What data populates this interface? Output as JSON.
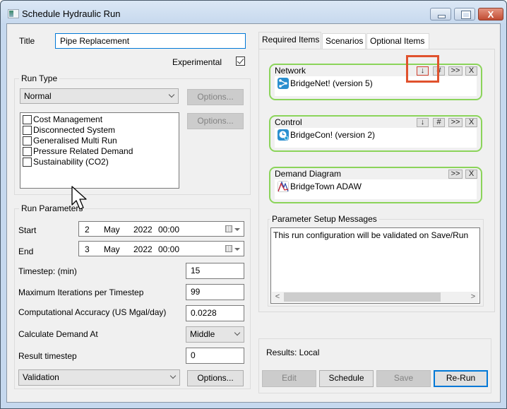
{
  "window": {
    "title": "Schedule Hydraulic Run",
    "controls": {
      "minimize": "minimize",
      "maximize": "maximize",
      "close": "X"
    }
  },
  "general": {
    "title_label": "Title",
    "title_value": "Pipe Replacement",
    "experimental_label": "Experimental",
    "experimental_checked": true
  },
  "run_type": {
    "group_label": "Run Type",
    "selected": "Normal",
    "options_button_1": "Options...",
    "options_button_2": "Options...",
    "modules": [
      {
        "label": "Cost Management",
        "checked": false
      },
      {
        "label": "Disconnected System",
        "checked": false
      },
      {
        "label": "Generalised Multi Run",
        "checked": false
      },
      {
        "label": "Pressure Related Demand",
        "checked": false
      },
      {
        "label": "Sustainability (CO2)",
        "checked": false
      }
    ]
  },
  "run_parameters": {
    "group_label": "Run Parameters",
    "start_label": "Start",
    "start": {
      "day": "2",
      "month": "May",
      "year": "2022",
      "time": "00:00"
    },
    "end_label": "End",
    "end": {
      "day": "3",
      "month": "May",
      "year": "2022",
      "time": "00:00"
    },
    "timestep_label": "Timestep: (min)",
    "timestep_value": "15",
    "max_iterations_label": "Maximum Iterations per Timestep",
    "max_iterations_value": "99",
    "accuracy_label": "Computational Accuracy (US Mgal/day)",
    "accuracy_value": "0.0228",
    "demand_at_label": "Calculate Demand At",
    "demand_at_value": "Middle",
    "result_timestep_label": "Result timestep",
    "result_timestep_value": "0",
    "validation_selected": "Validation",
    "options_button": "Options..."
  },
  "tabs": [
    {
      "label": "Required Items",
      "active": true
    },
    {
      "label": "Scenarios",
      "active": false
    },
    {
      "label": "Optional Items",
      "active": false
    }
  ],
  "required_items": {
    "network": {
      "title": "Network",
      "item": "BridgeNet! (version 5)",
      "icon": "network-icon",
      "buttons": [
        "↓",
        "#",
        ">>",
        "X"
      ]
    },
    "control": {
      "title": "Control",
      "item": "BridgeCon! (version 2)",
      "icon": "clock-icon",
      "buttons": [
        "↓",
        "#",
        ">>",
        "X"
      ]
    },
    "demand_diagram": {
      "title": "Demand Diagram",
      "item": "BridgeTown ADAW",
      "icon": "demand-diagram-icon",
      "buttons": [
        ">>",
        "X"
      ]
    },
    "messages": {
      "group_label": "Parameter Setup Messages",
      "text": "This run configuration will be validated on Save/Run"
    }
  },
  "results": {
    "label": "Results: Local",
    "buttons": {
      "edit": "Edit",
      "schedule": "Schedule",
      "save": "Save",
      "rerun": "Re-Run"
    }
  },
  "colors": {
    "accent": "#0078d7",
    "item_box_border": "#8bd45a",
    "highlight": "#e0522d",
    "close_button": "#c94f36"
  }
}
